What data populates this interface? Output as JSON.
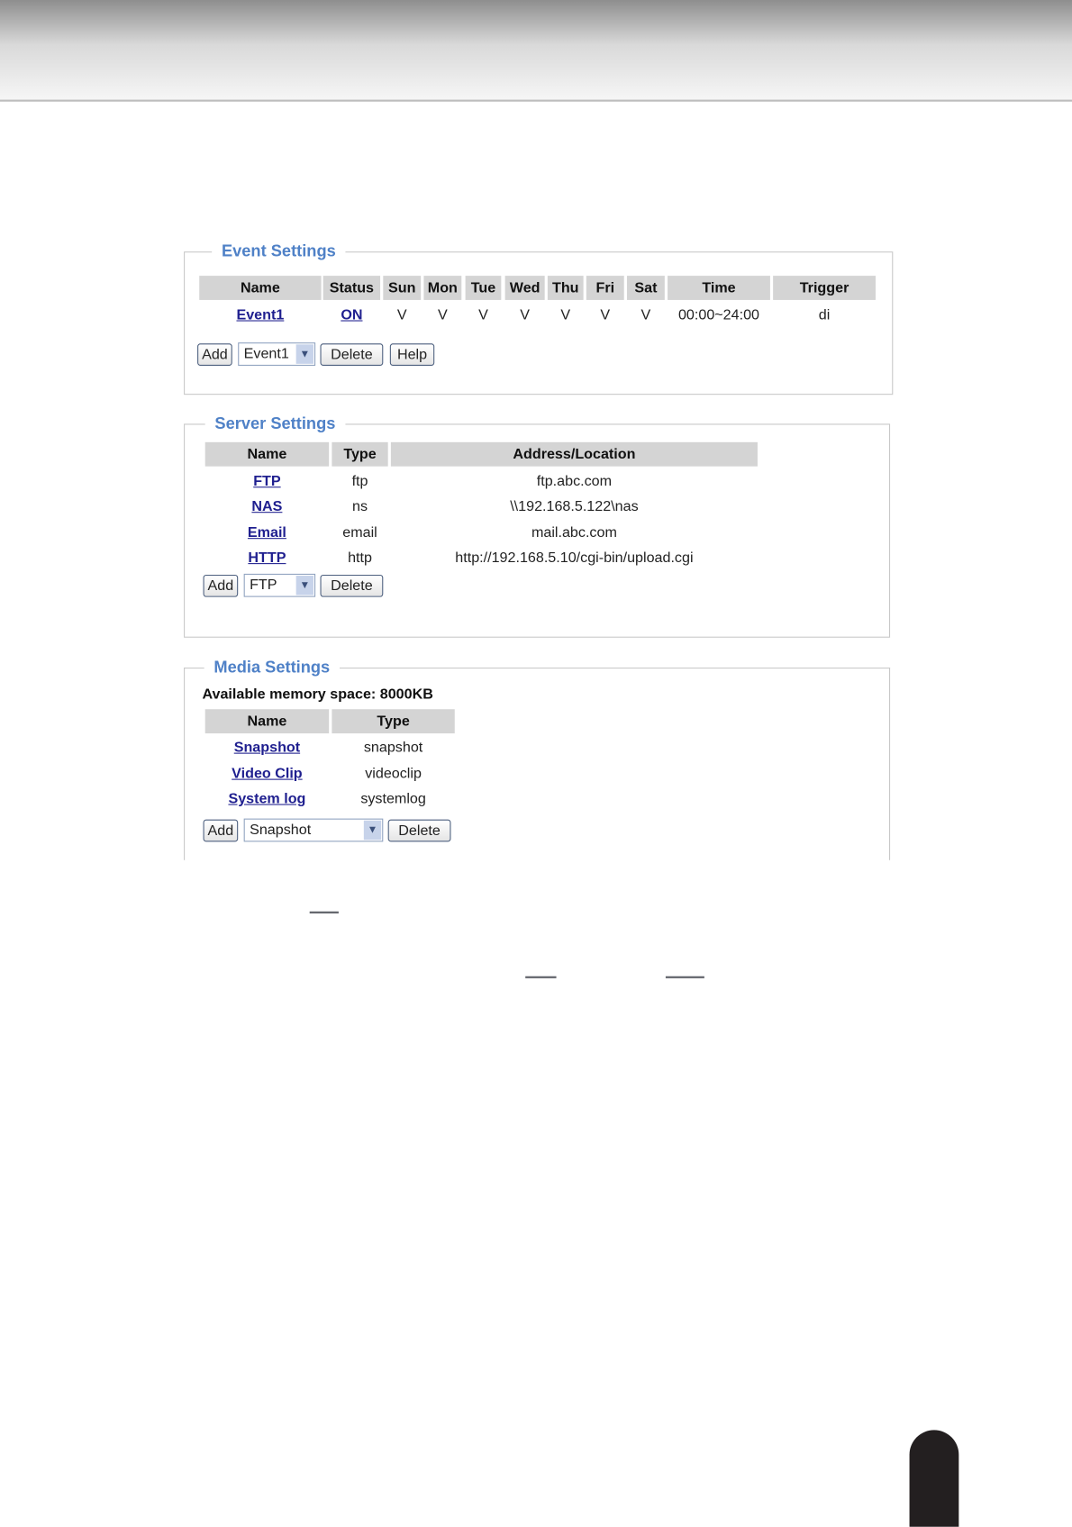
{
  "event_settings": {
    "title": "Event Settings",
    "columns": [
      "Name",
      "Status",
      "Sun",
      "Mon",
      "Tue",
      "Wed",
      "Thu",
      "Fri",
      "Sat",
      "Time",
      "Trigger"
    ],
    "rows": [
      [
        "Event1",
        "ON",
        "V",
        "V",
        "V",
        "V",
        "V",
        "V",
        "V",
        "00:00~24:00",
        "di"
      ]
    ],
    "add_label": "Add",
    "select_value": "Event1",
    "delete_label": "Delete",
    "help_label": "Help"
  },
  "server_settings": {
    "title": "Server Settings",
    "columns": [
      "Name",
      "Type",
      "Address/Location"
    ],
    "rows": [
      [
        "FTP",
        "ftp",
        "ftp.abc.com"
      ],
      [
        "NAS",
        "ns",
        "\\\\192.168.5.122\\nas"
      ],
      [
        "Email",
        "email",
        "mail.abc.com"
      ],
      [
        "HTTP",
        "http",
        "http://192.168.5.10/cgi-bin/upload.cgi"
      ]
    ],
    "add_label": "Add",
    "select_value": "FTP",
    "delete_label": "Delete"
  },
  "media_settings": {
    "title": "Media Settings",
    "memory": "Available memory space: 8000KB",
    "columns": [
      "Name",
      "Type"
    ],
    "rows": [
      [
        "Snapshot",
        "snapshot"
      ],
      [
        "Video Clip",
        "videoclip"
      ],
      [
        "System log",
        "systemlog"
      ]
    ],
    "add_label": "Add",
    "select_value": "Snapshot",
    "delete_label": "Delete"
  }
}
